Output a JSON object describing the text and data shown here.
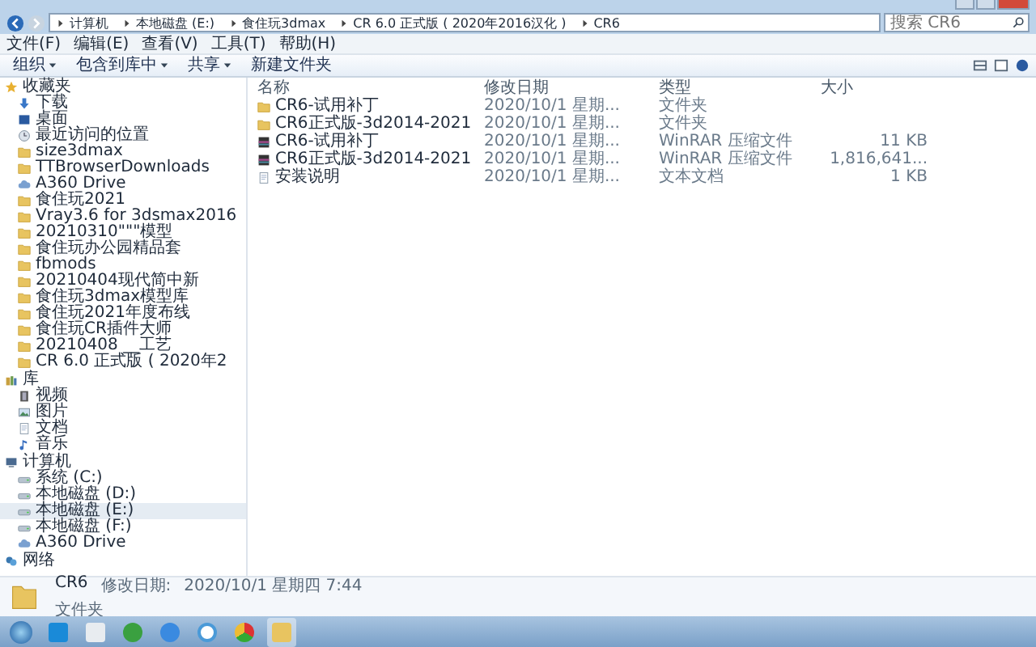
{
  "address_bar": {
    "crumbs": [
      "计算机",
      "本地磁盘 (E:)",
      "食住玩3dmax",
      "CR 6.0 正式版 ( 2020年2016汉化 )",
      "CR6"
    ]
  },
  "search": {
    "placeholder": "搜索 CR6"
  },
  "menu": [
    "文件(F)",
    "编辑(E)",
    "查看(V)",
    "工具(T)",
    "帮助(H)"
  ],
  "toolbar": [
    {
      "label": "组织",
      "dropdown": true
    },
    {
      "label": "包含到库中",
      "dropdown": true
    },
    {
      "label": "共享",
      "dropdown": true
    },
    {
      "label": "新建文件夹",
      "dropdown": false
    }
  ],
  "sidebar": [
    {
      "title": "收藏夹",
      "kind": "star",
      "items": [
        {
          "label": "下载",
          "kind": "download",
          "selected": false
        },
        {
          "label": "桌面",
          "kind": "desktop",
          "selected": false
        },
        {
          "label": "最近访问的位置",
          "kind": "recent",
          "selected": false
        },
        {
          "label": "size3dmax",
          "kind": "folder",
          "selected": false
        },
        {
          "label": "TTBrowserDownloads",
          "kind": "folder",
          "selected": false
        },
        {
          "label": "A360 Drive",
          "kind": "cloud",
          "selected": false
        },
        {
          "label": "食住玩2021",
          "kind": "folder",
          "selected": false
        },
        {
          "label": "Vray3.6 for 3dsmax2016",
          "kind": "folder",
          "selected": false
        },
        {
          "label": "20210310\"\"\"模型",
          "kind": "folder",
          "selected": false
        },
        {
          "label": "食住玩办公园精品套",
          "kind": "folder",
          "selected": false
        },
        {
          "label": "fbmods",
          "kind": "folder",
          "selected": false
        },
        {
          "label": "20210404现代简中新",
          "kind": "folder",
          "selected": false
        },
        {
          "label": "食住玩3dmax模型库",
          "kind": "folder",
          "selected": false
        },
        {
          "label": "食住玩2021年度布线",
          "kind": "folder",
          "selected": false
        },
        {
          "label": "食住玩CR插件大师",
          "kind": "folder",
          "selected": false
        },
        {
          "label": "20210408 __工艺",
          "kind": "folder",
          "selected": false
        },
        {
          "label": "CR 6.0 正式版 ( 2020年2",
          "kind": "folder",
          "selected": false
        }
      ]
    },
    {
      "title": "库",
      "kind": "library",
      "items": [
        {
          "label": "视频",
          "kind": "video",
          "selected": false
        },
        {
          "label": "图片",
          "kind": "picture",
          "selected": false
        },
        {
          "label": "文档",
          "kind": "document",
          "selected": false
        },
        {
          "label": "音乐",
          "kind": "music",
          "selected": false
        }
      ]
    },
    {
      "title": "计算机",
      "kind": "computer",
      "items": [
        {
          "label": "系统 (C:)",
          "kind": "drive",
          "selected": false
        },
        {
          "label": "本地磁盘 (D:)",
          "kind": "drive",
          "selected": false
        },
        {
          "label": "本地磁盘 (E:)",
          "kind": "drive",
          "selected": true
        },
        {
          "label": "本地磁盘 (F:)",
          "kind": "drive",
          "selected": false
        },
        {
          "label": "A360 Drive",
          "kind": "cloud",
          "selected": false
        }
      ]
    },
    {
      "title": "网络",
      "kind": "network"
    }
  ],
  "table": {
    "columns": [
      "名称",
      "修改日期",
      "类型",
      "大小"
    ],
    "rows": [
      {
        "kind": "folder",
        "name": "CR6-试用补丁",
        "date": "2020/10/1 星期...",
        "type": "文件夹",
        "size": "",
        "selected": false
      },
      {
        "kind": "folder",
        "name": "CR6正式版-3d2014-2021",
        "date": "2020/10/1 星期...",
        "type": "文件夹",
        "size": "",
        "selected": false
      },
      {
        "kind": "archive",
        "name": "CR6-试用补丁",
        "date": "2020/10/1 星期...",
        "type": "WinRAR 压缩文件",
        "size": "11 KB",
        "selected": false
      },
      {
        "kind": "archive",
        "name": "CR6正式版-3d2014-2021",
        "date": "2020/10/1 星期...",
        "type": "WinRAR 压缩文件",
        "size": "1,816,641...",
        "selected": false
      },
      {
        "kind": "text",
        "name": "安装说明",
        "date": "2020/10/1 星期...",
        "type": "文本文档",
        "size": "1 KB",
        "selected": false
      }
    ]
  },
  "details_pane": {
    "name": "CR6",
    "date_label": "修改日期:",
    "date": "2020/10/1 星期四 7:44",
    "type": "文件夹"
  },
  "taskbar": {
    "apps": [
      {
        "kind": "start"
      },
      {
        "kind": "blue-s"
      },
      {
        "kind": "document"
      },
      {
        "kind": "ie"
      },
      {
        "kind": "cloud"
      },
      {
        "kind": "rings"
      },
      {
        "kind": "chrome"
      },
      {
        "kind": "folder",
        "selected": true
      }
    ]
  }
}
